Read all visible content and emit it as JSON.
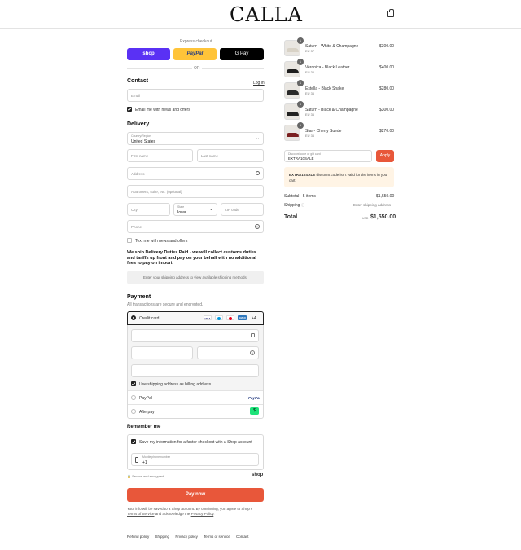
{
  "header": {
    "logo": "CALLA",
    "cart_icon": "bag-icon"
  },
  "express": {
    "title": "Express checkout",
    "shop": "shop",
    "paypal": "PayPal",
    "gpay": "G Pay",
    "or": "OR"
  },
  "contact": {
    "title": "Contact",
    "login": "Log in",
    "email_placeholder": "Email",
    "news_label": "Email me with news and offers"
  },
  "delivery": {
    "title": "Delivery",
    "country_label": "Country/Region",
    "country_value": "United States",
    "first_name": "First name",
    "last_name": "Last name",
    "address": "Address",
    "apartment": "Apartment, suite, etc. (optional)",
    "city": "City",
    "state_label": "State",
    "state_value": "Iowa",
    "zip": "ZIP code",
    "phone": "Phone",
    "text_label": "Text me with news and offers",
    "duty_notice": "We ship Delivery Duties Paid - we will collect customs duties and tariffs up front and pay on your behalf with no additional fees to pay on import",
    "shipping_notice": "Enter your shipping address to view available shipping methods."
  },
  "payment": {
    "title": "Payment",
    "subtitle": "All transactions are secure and encrypted.",
    "credit_card": "Credit card",
    "cards": [
      "VISA",
      "",
      "",
      "AMEX"
    ],
    "more": "+4",
    "billing_label": "Use shipping address as billing address",
    "paypal": "PayPal",
    "paypal_logo": "PayPal",
    "afterpay": "Afterpay",
    "afterpay_logo": "$"
  },
  "remember": {
    "title": "Remember me",
    "save_label": "Save my information for a faster checkout with a Shop account",
    "phone_label": "Mobile phone number",
    "phone_value": "+1",
    "secure": "Secure and encrypted",
    "shop": "shop"
  },
  "pay_now": "Pay now",
  "legal": {
    "line1": "Your info will be saved to a Shop account. By continuing, you agree to Shop's",
    "terms": "Terms of Service",
    "and": "and acknowledge the",
    "privacy": "Privacy Policy",
    "period": "."
  },
  "footer": [
    "Refund policy",
    "Shipping",
    "Privacy policy",
    "Terms of service",
    "Contact"
  ],
  "cart": {
    "items": [
      {
        "name": "Saturn - White & Champagne",
        "size": "EU 37",
        "price": "$300.00",
        "qty": "1",
        "color": "#d8d2c6"
      },
      {
        "name": "Veronica - Black Leather",
        "size": "EU 36",
        "price": "$400.00",
        "qty": "1",
        "color": "#1e1e1e"
      },
      {
        "name": "Estella - Black Snake",
        "size": "EU 36",
        "price": "$280.00",
        "qty": "1",
        "color": "#2a2a2a"
      },
      {
        "name": "Saturn - Black & Champagne",
        "size": "EU 36",
        "price": "$300.00",
        "qty": "1",
        "color": "#222"
      },
      {
        "name": "Star - Cherry Suede",
        "size": "EU 36",
        "price": "$270.00",
        "qty": "1",
        "color": "#7a1f1f"
      }
    ],
    "discount_label": "Discount code or gift card",
    "discount_value": "EXTRA10SALE",
    "apply": "Apply",
    "warning_code": "EXTRA10SALE",
    "warning_text": "discount code isn't valid for the items in your cart",
    "subtotal_label": "Subtotal · 5 items",
    "subtotal": "$1,550.00",
    "shipping_label": "Shipping",
    "shipping_value": "Enter shipping address",
    "total_label": "Total",
    "currency": "USD",
    "total": "$1,550.00"
  }
}
